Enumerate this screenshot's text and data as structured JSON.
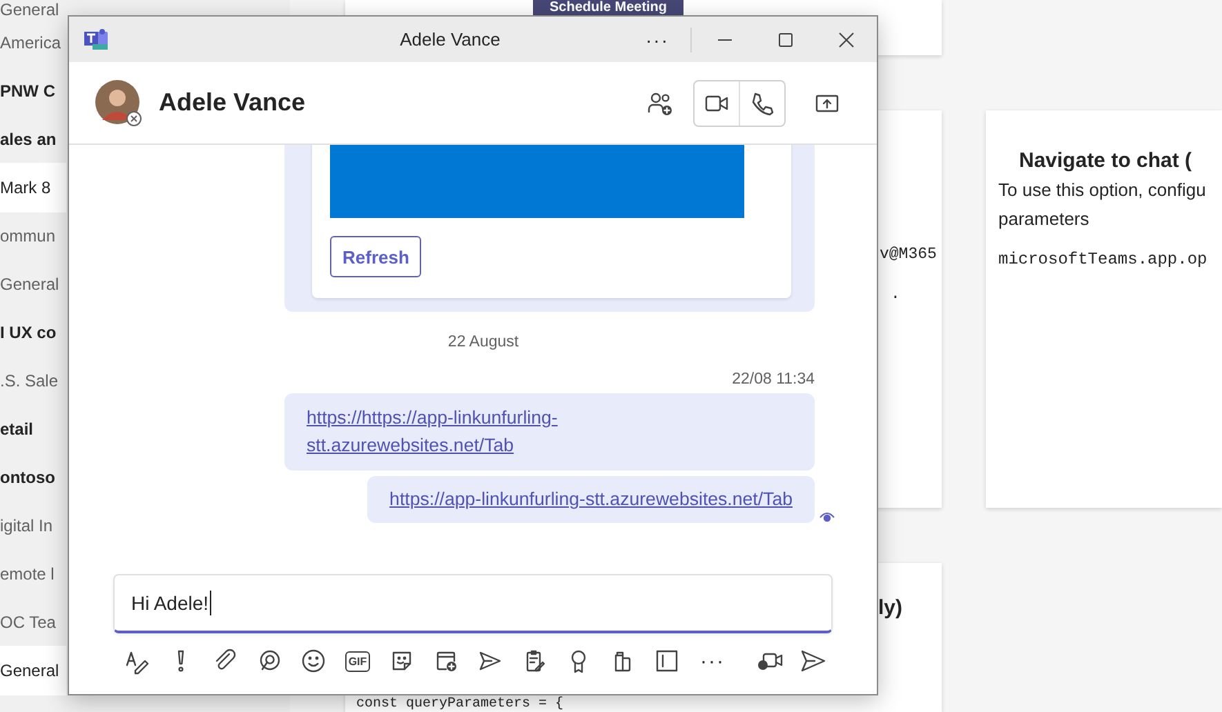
{
  "background": {
    "sidebar_items": [
      {
        "label": "General",
        "selected": false,
        "unread": false
      },
      {
        "label": "America",
        "selected": false,
        "unread": false
      },
      {
        "label": "PNW C",
        "selected": false,
        "unread": true
      },
      {
        "label": "ales an",
        "selected": false,
        "unread": true
      },
      {
        "label": "Mark 8",
        "selected": true,
        "unread": false
      },
      {
        "label": "ommun",
        "selected": false,
        "unread": false
      },
      {
        "label": "General",
        "selected": false,
        "unread": false
      },
      {
        "label": "I UX co",
        "selected": false,
        "unread": true
      },
      {
        "label": ".S. Sale",
        "selected": false,
        "unread": false
      },
      {
        "label": "etail",
        "selected": false,
        "unread": true
      },
      {
        "label": "ontoso",
        "selected": false,
        "unread": true
      },
      {
        "label": "igital In",
        "selected": false,
        "unread": false
      },
      {
        "label": "emote l",
        "selected": false,
        "unread": false
      },
      {
        "label": "OC Tea",
        "selected": false,
        "unread": false
      },
      {
        "label": "General",
        "selected": true,
        "unread": false
      }
    ],
    "cards": [
      {
        "kind": "button",
        "button": "Schedule Meeting"
      },
      {
        "kind": "code_tail",
        "lines": [
          "v@M365",
          "."
        ]
      },
      {
        "kind": "info",
        "title": "Navigate to chat (",
        "text": "To use this option, configu",
        "text_2": "parameters",
        "code": "microsoftTeams.app.op"
      },
      {
        "kind": "bottom",
        "title": "ly)",
        "code": "const queryParameters = {"
      }
    ]
  },
  "window": {
    "title": "Adele Vance",
    "more": "···",
    "header": {
      "name": "Adele Vance"
    },
    "messages": {
      "refresh_button": "Refresh",
      "date": "22 August",
      "time": "22/08 11:34",
      "links": [
        "https://https://app-linkunfurling-stt.azurewebsites.net/Tab",
        "https://app-linkunfurling-stt.azurewebsites.net/Tab"
      ]
    },
    "compose": {
      "value": "Hi Adele!",
      "gif_label": "GIF",
      "more": "···"
    }
  }
}
